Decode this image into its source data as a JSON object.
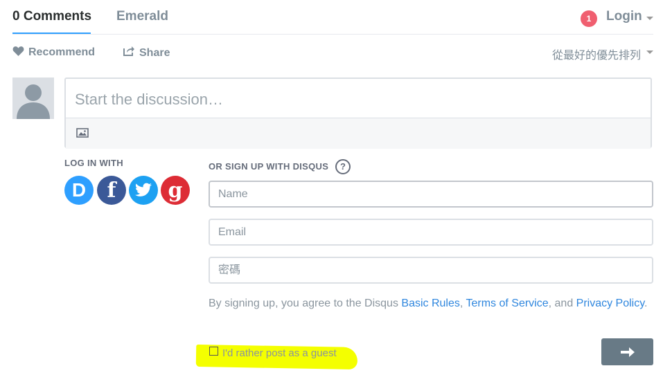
{
  "nav": {
    "comments_tab": "0 Comments",
    "forum_tab": "Emerald",
    "notification_count": "1",
    "login_label": "Login"
  },
  "actions": {
    "recommend_label": "Recommend",
    "share_label": "Share",
    "sort_label": "從最好的優先排列"
  },
  "composer": {
    "placeholder": "Start the discussion…"
  },
  "login_with": {
    "heading": "LOG IN WITH",
    "providers": [
      {
        "name": "Disqus",
        "glyph": "D",
        "color": "#2e9fff",
        "icon": "disqus-icon"
      },
      {
        "name": "Facebook",
        "glyph": "f",
        "color": "#3b5998",
        "icon": "facebook-icon"
      },
      {
        "name": "Twitter",
        "glyph": "",
        "color": "#1da1f2",
        "icon": "twitter-icon"
      },
      {
        "name": "Google",
        "glyph": "g",
        "color": "#dd2c35",
        "icon": "google-icon"
      }
    ]
  },
  "signup": {
    "heading": "OR SIGN UP WITH DISQUS",
    "help_glyph": "?",
    "name_placeholder": "Name",
    "email_placeholder": "Email",
    "password_placeholder": "密碼",
    "tos_prefix": "By signing up, you agree to the Disqus ",
    "basic_rules": "Basic Rules",
    "sep1": ", ",
    "terms": "Terms of Service",
    "sep2": ", and ",
    "privacy": "Privacy Policy",
    "tos_suffix": ".",
    "guest_label": "I'd rather post as a guest"
  },
  "colors": {
    "accent": "#2e9fff",
    "badge": "#f05f70",
    "link": "#2e86de",
    "submit": "#687a86",
    "highlight": "#f4ff00"
  }
}
